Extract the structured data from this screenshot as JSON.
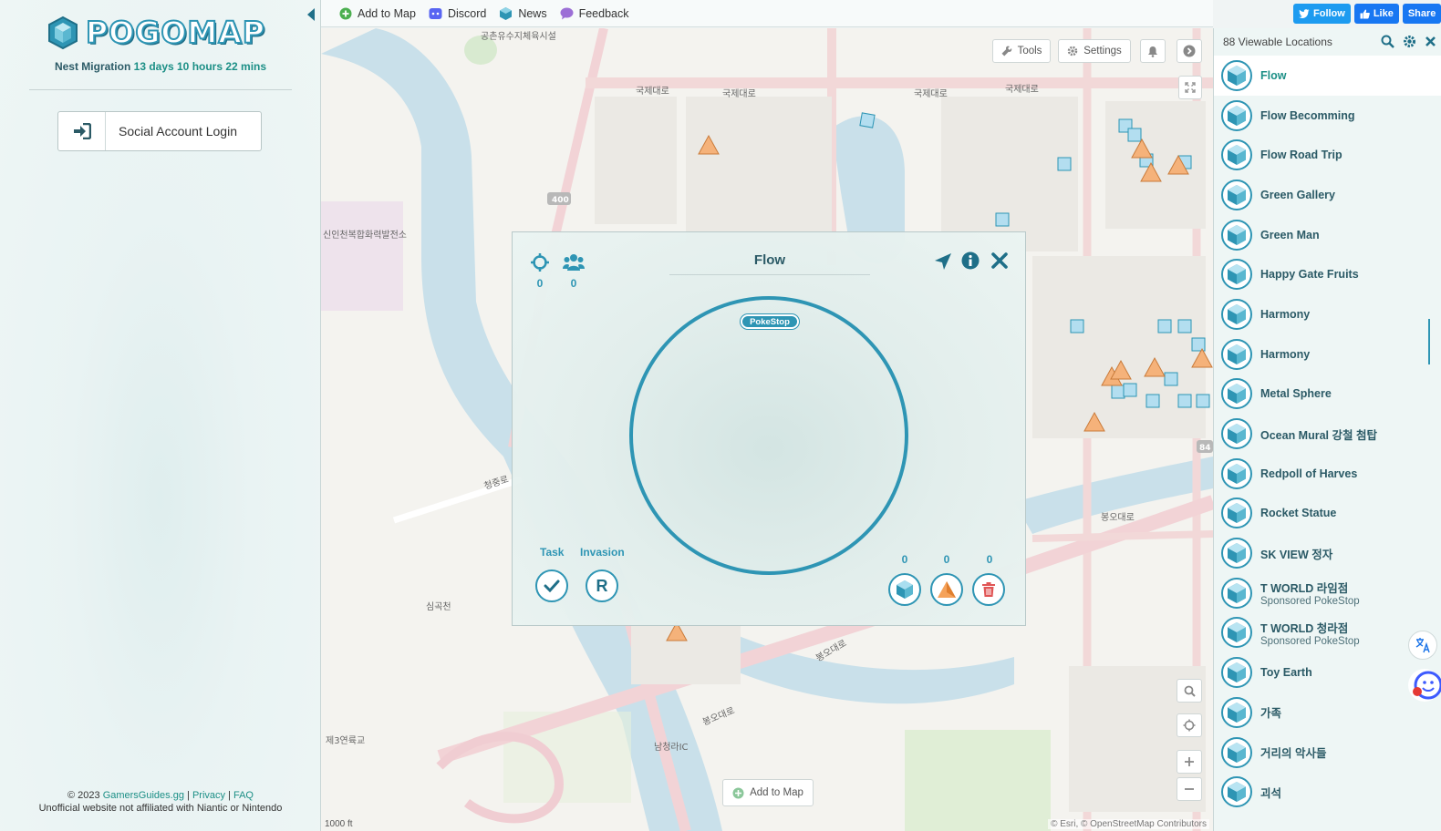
{
  "brand": {
    "name": "POGOMAP",
    "nest_migration_label": "Nest Migration",
    "nest_migration_timer": "13 days 10 hours 22 mins"
  },
  "login": {
    "label": "Social Account Login"
  },
  "footer": {
    "copyright": "© 2023",
    "site_link": "GamersGuides.gg",
    "sep": "|",
    "privacy": "Privacy",
    "faq": "FAQ",
    "disclaimer": "Unofficial website not affiliated with Niantic or Nintendo"
  },
  "topbar": {
    "add_to_map": "Add to Map",
    "discord": "Discord",
    "news": "News",
    "feedback": "Feedback"
  },
  "social": {
    "follow": "Follow",
    "like": "Like",
    "share": "Share"
  },
  "map": {
    "tools": "Tools",
    "settings": "Settings",
    "add_to_map": "Add to Map",
    "attribution": "© Esri, © OpenStreetMap Contributors",
    "scale": "1000 ft",
    "labels": {
      "road1": "국제대로",
      "road2": "국제대로",
      "road3": "국제대로",
      "road4": "국제대로",
      "road_bongo": "봉오대로",
      "road_bongo2": "봉오대로",
      "road_bongo3": "봉오대로",
      "cheongjung": "청중로",
      "route400": "400",
      "route84": "84",
      "simgok": "심곡천",
      "namcheongra": "남청라IC",
      "je3": "제3연륙교",
      "sinin": "신인천복합화력발전소",
      "chundang": "공촌유수지체육시설"
    }
  },
  "modal": {
    "title": "Flow",
    "pin_count": "0",
    "people_count": "0",
    "pill": "PokeStop",
    "task_label": "Task",
    "invasion_label": "Invasion",
    "invasion_letter": "R",
    "stop_count": "0",
    "gym_count": "0",
    "delete_count": "0"
  },
  "locations": {
    "count_label": "88 Viewable Locations",
    "items": [
      {
        "name": "Flow",
        "sub": ""
      },
      {
        "name": "Flow Becomming",
        "sub": ""
      },
      {
        "name": "Flow Road Trip",
        "sub": ""
      },
      {
        "name": "Green Gallery",
        "sub": ""
      },
      {
        "name": "Green Man",
        "sub": ""
      },
      {
        "name": "Happy Gate Fruits",
        "sub": ""
      },
      {
        "name": "Harmony",
        "sub": ""
      },
      {
        "name": "Harmony",
        "sub": ""
      },
      {
        "name": "Metal Sphere",
        "sub": ""
      },
      {
        "name": "Ocean Mural 강철 첨탑",
        "sub": ""
      },
      {
        "name": "Redpoll of Harves",
        "sub": ""
      },
      {
        "name": "Rocket Statue",
        "sub": ""
      },
      {
        "name": "SK VIEW 정자",
        "sub": ""
      },
      {
        "name": "T WORLD 라임점",
        "sub": "Sponsored PokeStop"
      },
      {
        "name": "T WORLD 청라점",
        "sub": "Sponsored PokeStop"
      },
      {
        "name": "Toy Earth",
        "sub": ""
      },
      {
        "name": "가족",
        "sub": ""
      },
      {
        "name": "거리의 악사들",
        "sub": ""
      },
      {
        "name": "괴석",
        "sub": ""
      }
    ]
  },
  "colors": {
    "accent": "#2e95b4",
    "teal_text": "#1c8f86",
    "gym_orange": "#f5a25a",
    "delete_red": "#e05555"
  }
}
